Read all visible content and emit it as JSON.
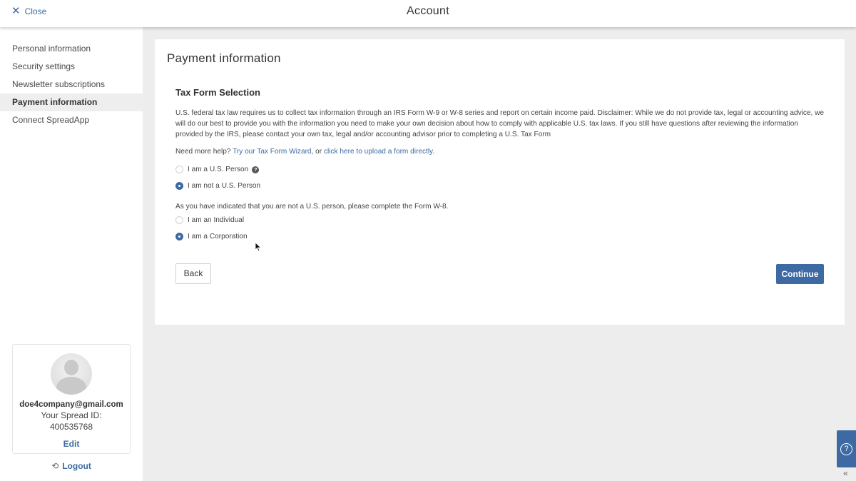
{
  "header": {
    "close_label": "Close",
    "title": "Account"
  },
  "sidebar": {
    "items": [
      {
        "label": "Personal information"
      },
      {
        "label": "Security settings"
      },
      {
        "label": "Newsletter subscriptions"
      },
      {
        "label": "Payment information",
        "active": true
      },
      {
        "label": "Connect SpreadApp"
      }
    ],
    "profile": {
      "email": "doe4company@gmail.com",
      "id_label": "Your Spread ID:",
      "id_value": "400535768",
      "edit_label": "Edit"
    },
    "logout_label": "Logout"
  },
  "main": {
    "title": "Payment information",
    "section_title": "Tax Form Selection",
    "disclaimer": "U.S. federal tax law requires us to collect tax information through an IRS Form W-9 or W-8 series and report on certain income paid. Disclaimer: While we do not provide tax, legal or accounting advice, we will do our best to provide you with the information you need to make your own decision about how to comply with applicable U.S. tax laws. If you still have questions after reviewing the information provided by the IRS, please contact your own tax, legal and/or accounting advisor prior to completing a U.S. Tax Form",
    "help": {
      "prefix": "Need more help?",
      "wizard_link": "Try our Tax Form Wizard",
      "middle": ", or",
      "upload_link": "click here to upload a form directly",
      "suffix": "."
    },
    "person_options": [
      {
        "label": "I am a U.S. Person",
        "checked": false
      },
      {
        "label": "I am not a U.S. Person",
        "checked": true
      }
    ],
    "w8_note": "As you have indicated that you are not a U.S. person, please complete the Form W-8.",
    "entity_options": [
      {
        "label": "I am an Individual",
        "checked": false
      },
      {
        "label": "I am a Corporation",
        "checked": true
      }
    ],
    "back_label": "Back",
    "continue_label": "Continue"
  },
  "widget": {
    "help_icon": "question-circle-icon",
    "collapse_icon": "double-chevron-left-icon"
  },
  "colors": {
    "accent": "#3d6aa3",
    "background": "#ededed"
  }
}
